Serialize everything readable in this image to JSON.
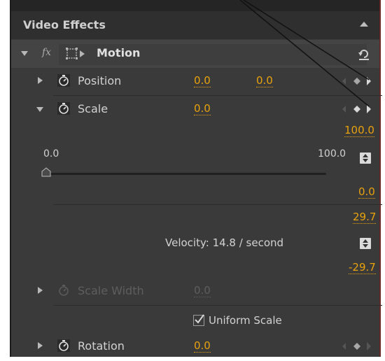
{
  "panel": {
    "title": "Video Effects"
  },
  "motion": {
    "fx_label": "fx",
    "title": "Motion"
  },
  "position": {
    "label": "Position",
    "x_value": "0.0",
    "y_value": "0.0"
  },
  "scale": {
    "label": "Scale",
    "value": "0.0",
    "graph_max": "100.0",
    "slider_min": "0.0",
    "slider_max": "100.0",
    "slider_level": 0.0,
    "graph_min": "0.0",
    "velocity_max": "29.7",
    "velocity_text": "Velocity: 14.8 / second",
    "velocity_min": "-29.7"
  },
  "scale_width": {
    "label": "Scale Width",
    "value": "0.0"
  },
  "uniform_scale": {
    "label": "Uniform Scale",
    "checked": true
  },
  "rotation": {
    "label": "Rotation",
    "value": "0.0"
  },
  "colors": {
    "panel_bg": "#3a3a3a",
    "header_bg": "#2f2f2f",
    "accent_value": "#e8a20c",
    "label_text": "#d2d2d2",
    "disabled_text": "#5e5e5e"
  },
  "icons": {
    "collapse": "chevron-up-icon",
    "stopwatch": "stopwatch-icon",
    "reset": "reset-icon",
    "keyframe_nav": "keyframe-navigator-icon",
    "stepper": "up-down-stepper-icon",
    "transform": "transform-icon"
  }
}
